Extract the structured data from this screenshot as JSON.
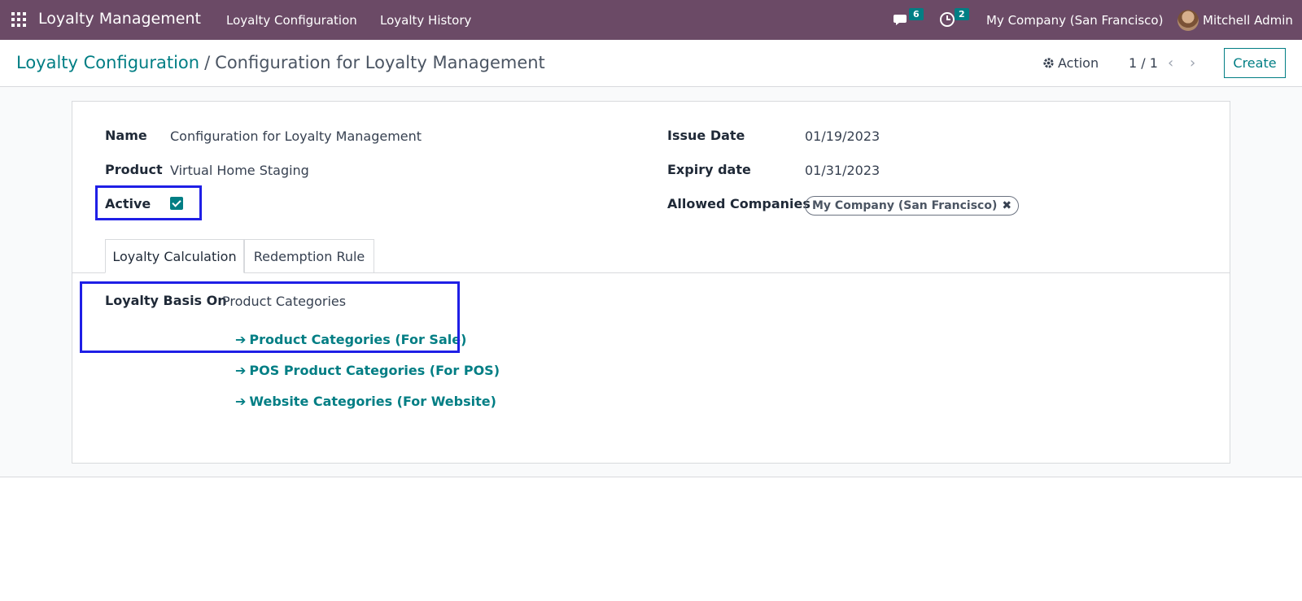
{
  "navbar": {
    "app_title": "Loyalty Management",
    "menu": [
      "Loyalty Configuration",
      "Loyalty History"
    ],
    "messages_count": "6",
    "activities_count": "2",
    "company": "My Company (San Francisco)",
    "user": "Mitchell Admin"
  },
  "control_panel": {
    "breadcrumb_parent": "Loyalty Configuration",
    "breadcrumb_sep": "/",
    "breadcrumb_current": "Configuration for Loyalty Management",
    "action_label": "Action",
    "pager": "1 / 1",
    "create_label": "Create"
  },
  "form": {
    "name_label": "Name",
    "name_value": "Configuration for Loyalty Management",
    "product_label": "Product",
    "product_value": "Virtual Home Staging",
    "active_label": "Active",
    "active_value": true,
    "issue_date_label": "Issue Date",
    "issue_date_value": "01/19/2023",
    "expiry_date_label": "Expiry date",
    "expiry_date_value": "01/31/2023",
    "allowed_companies_label": "Allowed Companies",
    "allowed_companies_tag": "My Company (San Francisco)"
  },
  "tabs": {
    "tab1": "Loyalty Calculation",
    "tab2": "Redemption Rule"
  },
  "loyalty_calc": {
    "basis_label": "Loyalty Basis On",
    "basis_value": "Product Categories",
    "links": [
      "Product Categories (For Sale)",
      "POS Product Categories (For POS)",
      "Website Categories (For Website)"
    ]
  },
  "colors": {
    "navbar": "#6b4a66",
    "accent": "#017e84",
    "highlight": "#1f1fe6"
  }
}
